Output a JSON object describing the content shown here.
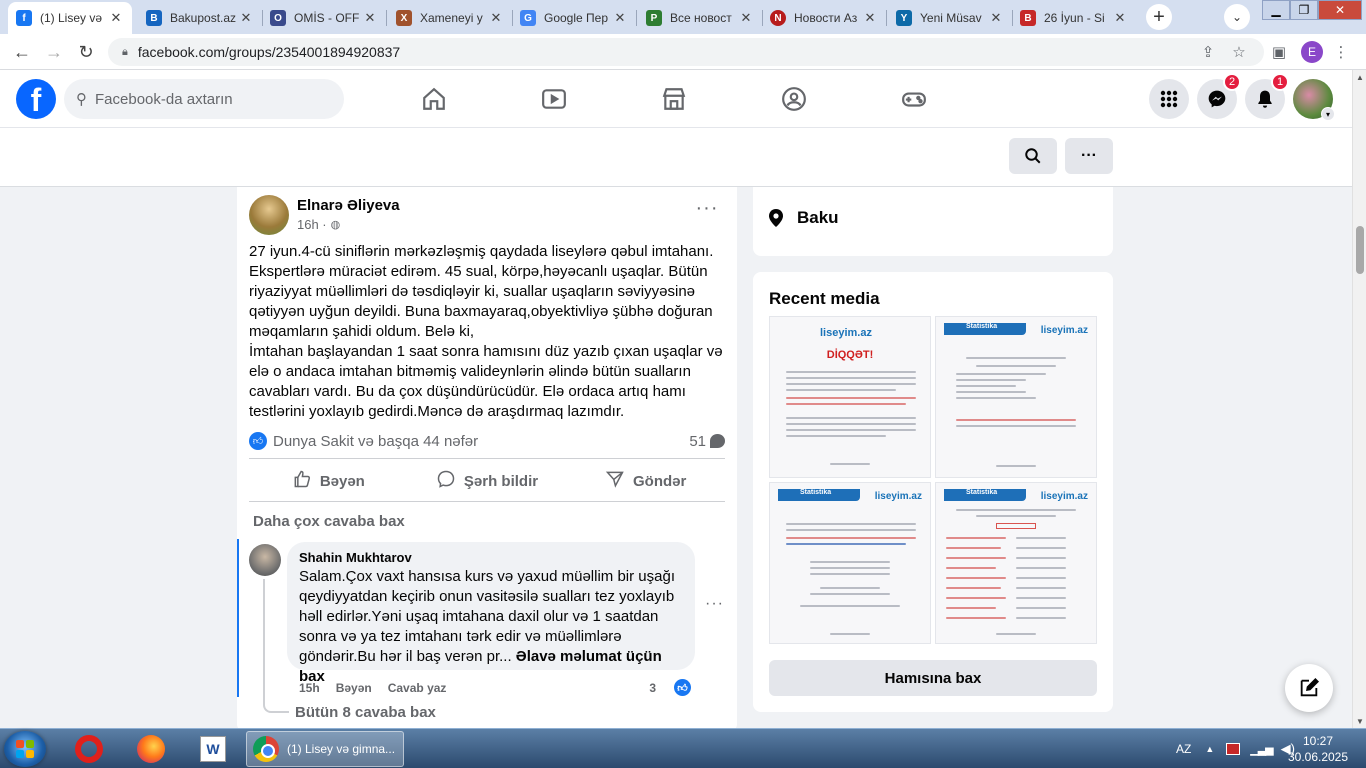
{
  "browser": {
    "tabs": [
      {
        "title": "(1) Lisey və",
        "favicon_color": "#1877f2",
        "favicon_glyph": "f",
        "active": true
      },
      {
        "title": "Bakupost.az",
        "favicon_color": "#1565c0",
        "favicon_glyph": "B",
        "active": false
      },
      {
        "title": "OMİS - OFF",
        "favicon_color": "#3a4a8c",
        "favicon_glyph": "O",
        "active": false
      },
      {
        "title": "Xameneyi y",
        "favicon_color": "#a0522d",
        "favicon_glyph": "X",
        "active": false
      },
      {
        "title": "Google Пер",
        "favicon_color": "#4285f4",
        "favicon_glyph": "G",
        "active": false
      },
      {
        "title": "Все новост",
        "favicon_color": "#2e7d32",
        "favicon_glyph": "P",
        "active": false
      },
      {
        "title": "Новости Аз",
        "favicon_color": "#b71c1c",
        "favicon_glyph": "N",
        "active": false
      },
      {
        "title": "Yeni Müsav",
        "favicon_color": "#0d6aa8",
        "favicon_glyph": "Y",
        "active": false
      },
      {
        "title": "26 İyun - Si",
        "favicon_color": "#c62828",
        "favicon_glyph": "B",
        "active": false
      }
    ],
    "close_glyph": "✕",
    "new_tab_glyph": "+",
    "url": "facebook.com/groups/2354001894920837",
    "profile_initial": "E"
  },
  "fb": {
    "logo_glyph": "f",
    "search_placeholder": "Facebook-da axtarın",
    "messenger_badge": "2",
    "notifications_badge": "1"
  },
  "group_header": {
    "search_glyph": "⌕",
    "more_glyph": "···"
  },
  "post": {
    "author": "Elnarə Əliyeva",
    "time": "16h ·",
    "text": "27 iyun.4-cü siniflərin mərkəzləşmiş qaydada liseylərə qəbul imtahanı. Ekspertlərə müraciət edirəm. 45 sual, körpə,həyəcanlı uşaqlar. Bütün riyaziyyat müəllimləri də təsdiqləyir ki, suallar uşaqların səviyyəsinə qətiyyən uyğun deyildi. Buna baxmayaraq,obyektivliyə şübhə doğuran məqamların şahidi oldum. Belə ki,\n İmtahan başlayandan 1 saat sonra hamısını düz yazıb çıxan uşaqlar və elə o andaca imtahan bitməmiş valideynlərin əlində   bütün sualların cavabları vardı. Bu da çox düşündürücüdür. Elə ordaca artıq hamı testlərini yoxlayıb gedirdi.Məncə də araşdırmaq lazımdır.",
    "reactions_text": "Dunya Sakit və başqa 44 nəfər",
    "comment_count": "51",
    "actions": {
      "like": "Bəyən",
      "comment": "Şərh bildir",
      "share": "Göndər"
    },
    "more_replies": "Daha çox cavaba bax",
    "reply": {
      "name": "Shahin Mukhtarov",
      "text": "Salam.Çox vaxt hansısa kurs və yaxud müəllim bir uşağı qeydiyyatdan keçirib onun vasitəsilə sualları tez yoxlayıb həll edirlər.Yəni uşaq imtahana daxil olur və 1 saatdan sonra və ya tez imtahanı tərk edir və müəllimlərə göndərir.Bu hər il baş verən pr...",
      "see_more": "Əlavə məlumat üçün bax",
      "time": "15h",
      "like": "Bəyən",
      "reply": "Cavab yaz",
      "like_count": "3"
    },
    "all_replies": "Bütün 8 cavaba bax"
  },
  "sidebar": {
    "location": "Baku",
    "recent_media_title": "Recent media",
    "see_all": "Hamısına bax",
    "thumbnails": {
      "logo": "liseyim.az",
      "thumb1_heading": "DİQQƏT!",
      "thumb2_header": "Statistika",
      "thumb3_header": "Statistika",
      "thumb4_header": "Statistika"
    }
  },
  "taskbar": {
    "active_window": "(1) Lisey və gimna...",
    "lang": "AZ",
    "time": "10:27",
    "date": "30.06.2025"
  }
}
